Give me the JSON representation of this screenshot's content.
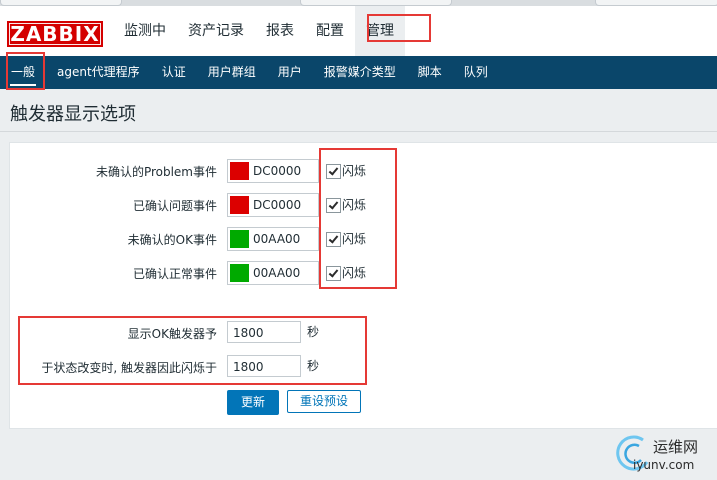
{
  "logo": "ZABBIX",
  "main_nav": [
    {
      "label": "监测中"
    },
    {
      "label": "资产记录"
    },
    {
      "label": "报表"
    },
    {
      "label": "配置"
    },
    {
      "label": "管理"
    }
  ],
  "sub_nav": [
    {
      "label": "一般"
    },
    {
      "label": "agent代理程序"
    },
    {
      "label": "认证"
    },
    {
      "label": "用户群组"
    },
    {
      "label": "用户"
    },
    {
      "label": "报警媒介类型"
    },
    {
      "label": "脚本"
    },
    {
      "label": "队列"
    }
  ],
  "page_title": "触发器显示选项",
  "events": [
    {
      "label": "未确认的Problem事件",
      "color": "#DC0000",
      "code": "DC0000",
      "blink_label": "闪烁",
      "blink": true
    },
    {
      "label": "已确认问题事件",
      "color": "#DC0000",
      "code": "DC0000",
      "blink_label": "闪烁",
      "blink": true
    },
    {
      "label": "未确认的OK事件",
      "color": "#00AA00",
      "code": "00AA00",
      "blink_label": "闪烁",
      "blink": true
    },
    {
      "label": "已确认正常事件",
      "color": "#00AA00",
      "code": "00AA00",
      "blink_label": "闪烁",
      "blink": true
    }
  ],
  "timing": {
    "ok_label": "显示OK触发器予",
    "ok_value": "1800",
    "blink_label": "于状态改变时, 触发器因此闪烁于",
    "blink_value": "1800",
    "unit": "秒"
  },
  "buttons": {
    "update": "更新",
    "reset": "重设预设"
  },
  "watermark": {
    "top": "运维网",
    "bottom": "iyunv.com"
  }
}
